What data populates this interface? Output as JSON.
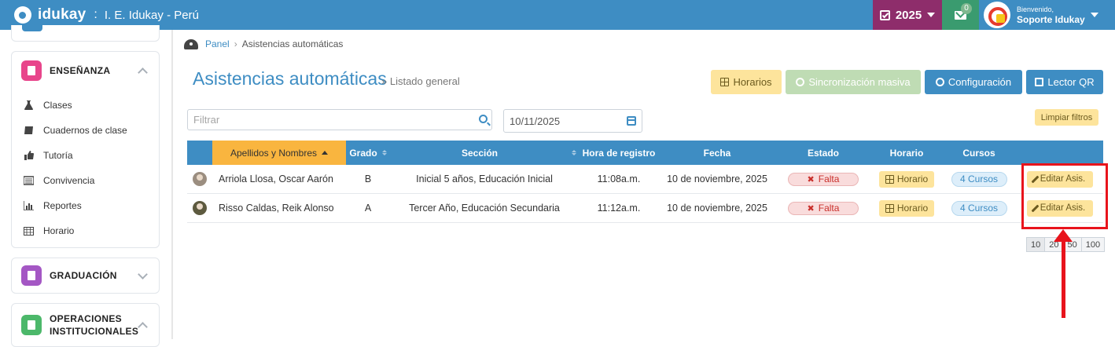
{
  "header": {
    "brand": "idukay",
    "separator": ":",
    "school": "I. E. Idukay - Perú",
    "year": "2025",
    "mail_count": "0",
    "welcome": "Bienvenido,",
    "user_name": "Soporte Idukay",
    "colors": {
      "bar": "#3e8dc3",
      "year": "#8e2d6b",
      "mail": "#3a9b6f"
    }
  },
  "sidebar": {
    "sections": [
      {
        "title": "ENSEÑANZA",
        "icon": "book-icon",
        "color": "#e8458b",
        "expanded": true,
        "items": [
          {
            "label": "Clases",
            "icon": "flask-icon"
          },
          {
            "label": "Cuadernos de clase",
            "icon": "notebook-icon"
          },
          {
            "label": "Tutoría",
            "icon": "thumbs-up-icon"
          },
          {
            "label": "Convivencia",
            "icon": "list-icon"
          },
          {
            "label": "Reportes",
            "icon": "bar-chart-icon"
          },
          {
            "label": "Horario",
            "icon": "calendar-icon"
          }
        ]
      },
      {
        "title": "GRADUACIÓN",
        "icon": "document-icon",
        "color": "#a457c4",
        "expanded": false
      },
      {
        "title": "OPERACIONES INSTITUCIONALES",
        "icon": "table-icon",
        "color": "#4cb86a",
        "expanded": true
      }
    ]
  },
  "breadcrumb": {
    "root": "Panel",
    "current": "Asistencias automáticas"
  },
  "page": {
    "title": "Asistencias automáticas",
    "subtitle": "» Listado general"
  },
  "actions": {
    "horarios": "Horarios",
    "sync": "Sincronización masiva",
    "config": "Configuración",
    "qr": "Lector QR"
  },
  "filters": {
    "search_placeholder": "Filtrar",
    "date": "10/11/2025",
    "clear": "Limpiar filtros"
  },
  "table": {
    "headers": [
      "Apellidos y Nombres",
      "Grado",
      "Sección",
      "Hora de registro",
      "Fecha",
      "Estado",
      "Horario",
      "Cursos"
    ],
    "rows": [
      {
        "name": "Arriola Llosa, Oscar Aarón",
        "grado": "B",
        "seccion": "Inicial 5 años, Educación Inicial",
        "hora": "11:08a.m.",
        "fecha": "10 de noviembre, 2025",
        "estado": "Falta",
        "horario": "Horario",
        "cursos": "4 Cursos",
        "edit": "Editar Asis."
      },
      {
        "name": "Risso Caldas, Reik Alonso",
        "grado": "A",
        "seccion": "Tercer Año, Educación Secundaria",
        "hora": "11:12a.m.",
        "fecha": "10 de noviembre, 2025",
        "estado": "Falta",
        "horario": "Horario",
        "cursos": "4 Cursos",
        "edit": "Editar Asis."
      }
    ]
  },
  "pagination": {
    "sizes": [
      "10",
      "20",
      "50",
      "100"
    ],
    "selected": "10"
  }
}
